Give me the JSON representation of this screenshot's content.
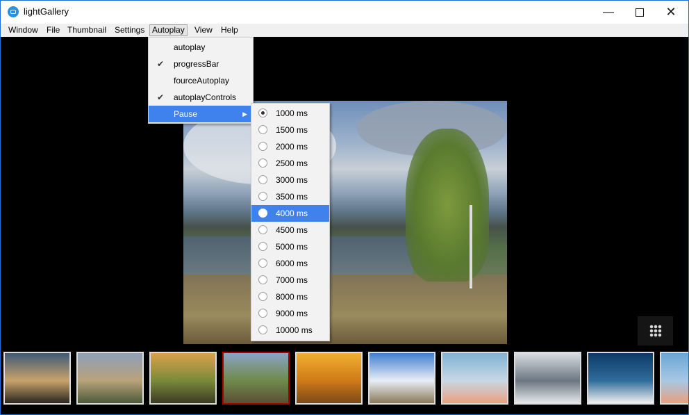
{
  "window": {
    "title": "lightGallery",
    "minimize_label": "—",
    "close_label": "✕"
  },
  "menubar": {
    "items": [
      {
        "label": "Window"
      },
      {
        "label": "File"
      },
      {
        "label": "Thumbnail"
      },
      {
        "label": "Settings"
      },
      {
        "label": "Autoplay"
      },
      {
        "label": "View"
      },
      {
        "label": "Help"
      }
    ],
    "active": "Autoplay"
  },
  "autoplay_menu": {
    "items": [
      {
        "label": "autoplay",
        "checked": false
      },
      {
        "label": "progressBar",
        "checked": true
      },
      {
        "label": "fourceAutoplay",
        "checked": false
      },
      {
        "label": "autoplayControls",
        "checked": true
      },
      {
        "label": "Pause",
        "submenu": true,
        "highlighted": true
      }
    ],
    "check_mark": "✔",
    "submenu_arrow": "▶"
  },
  "pause_submenu": {
    "items": [
      {
        "label": "1000 ms",
        "selected": true
      },
      {
        "label": "1500 ms"
      },
      {
        "label": "2000 ms"
      },
      {
        "label": "2500 ms"
      },
      {
        "label": "3000 ms"
      },
      {
        "label": "3500 ms"
      },
      {
        "label": "4000 ms",
        "highlighted": true
      },
      {
        "label": "4500 ms"
      },
      {
        "label": "5000 ms"
      },
      {
        "label": "6000 ms"
      },
      {
        "label": "7000 ms"
      },
      {
        "label": "8000 ms"
      },
      {
        "label": "9000 ms"
      },
      {
        "label": "10000 ms"
      }
    ]
  },
  "colors": {
    "menu_highlight": "#3f82ee",
    "selected_thumb_border": "#aa0000",
    "window_border": "#1d6ed6"
  },
  "thumbnails": [
    {
      "name": "sunset-pier",
      "colors": [
        "#3f5a78",
        "#c9a36a",
        "#2a2620"
      ]
    },
    {
      "name": "mountain-lake",
      "colors": [
        "#8ea0b8",
        "#b9a27a",
        "#4b5a3a"
      ]
    },
    {
      "name": "autumn-forest",
      "colors": [
        "#d9a24a",
        "#7a8a3a",
        "#3b3a22"
      ]
    },
    {
      "name": "lake-tree",
      "colors": [
        "#8ba3c4",
        "#6f8a4a",
        "#5a4e36"
      ],
      "selected": true
    },
    {
      "name": "golden-trees",
      "colors": [
        "#f0b030",
        "#d07a18",
        "#7a4a18"
      ]
    },
    {
      "name": "blue-sky-road",
      "colors": [
        "#3f7fd0",
        "#e8eef6",
        "#8a7a5a"
      ]
    },
    {
      "name": "lighthouse",
      "colors": [
        "#7fb2d6",
        "#c8d8e4",
        "#e8a080"
      ]
    },
    {
      "name": "foggy-peaks",
      "colors": [
        "#d8dde2",
        "#6a7682",
        "#e6e8ea"
      ]
    },
    {
      "name": "cloud-horizon",
      "colors": [
        "#0e3a66",
        "#2f6c9c",
        "#f0f0f0"
      ]
    },
    {
      "name": "partial-sky",
      "colors": [
        "#6aa6d6",
        "#a8c8e4",
        "#e8a080"
      ]
    }
  ]
}
